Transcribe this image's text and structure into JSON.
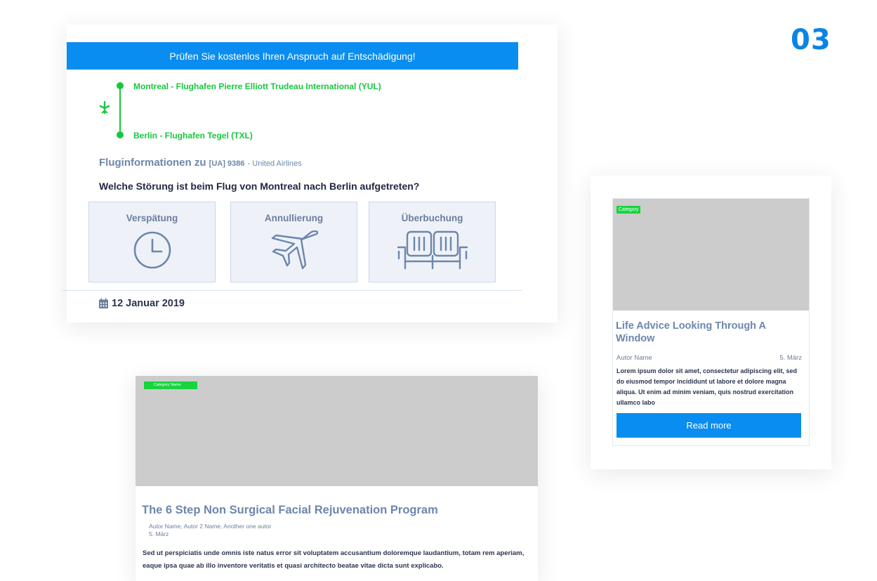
{
  "page_number": "03",
  "colors": {
    "accent_blue": "#0a8df0",
    "route_green": "#17c83f",
    "muted_blue": "#6c86ad",
    "placeholder_gray": "#cccccc"
  },
  "flight_card": {
    "banner": "Prüfen Sie kostenlos Ihren Anspruch auf Entschädigung!",
    "route": {
      "origin": "Montreal - Flughafen Pierre Elliott Trudeau International (YUL)",
      "destination": "Berlin - Flughafen Tegel (TXL)",
      "icon": "airplane-landing-icon"
    },
    "info_label": "Fluginformationen zu",
    "flight_number": "[UA] 9386",
    "airline": "- United Airlines",
    "question": "Welche Störung ist beim Flug von Montreal nach Berlin aufgetreten?",
    "options": [
      {
        "label": "Verspätung",
        "icon": "clock-icon"
      },
      {
        "label": "Annullierung",
        "icon": "airplane-icon"
      },
      {
        "label": "Überbuchung",
        "icon": "seats-icon"
      }
    ],
    "date": "12 Januar 2019",
    "date_icon": "calendar-icon"
  },
  "article_card": {
    "category": "Category",
    "title": "Life Advice Looking Through A Window",
    "author": "Autor Name",
    "date": "5. März",
    "excerpt": "Lorem ipsum dolor sit amet, consectetur adipiscing elit, sed do eiusmod tempor incididunt ut labore et dolore magna aliqua. Ut enim ad minim veniam, quis nostrud exercitation ullamco labo",
    "button_label": "Read more"
  },
  "feature_article": {
    "category": "Category Name",
    "title": "The 6 Step Non Surgical Facial Rejuvenation Program",
    "authors": "Autor Name, Autor 2 Name, Another one autor",
    "date": "5. März",
    "excerpt": "Sed ut perspiciatis unde omnis iste natus error sit voluptatem accusantium doloremque laudantium, totam rem aperiam, eaque ipsa quae ab illo inventore veritatis et quasi architecto beatae vitae dicta sunt explicabo."
  }
}
